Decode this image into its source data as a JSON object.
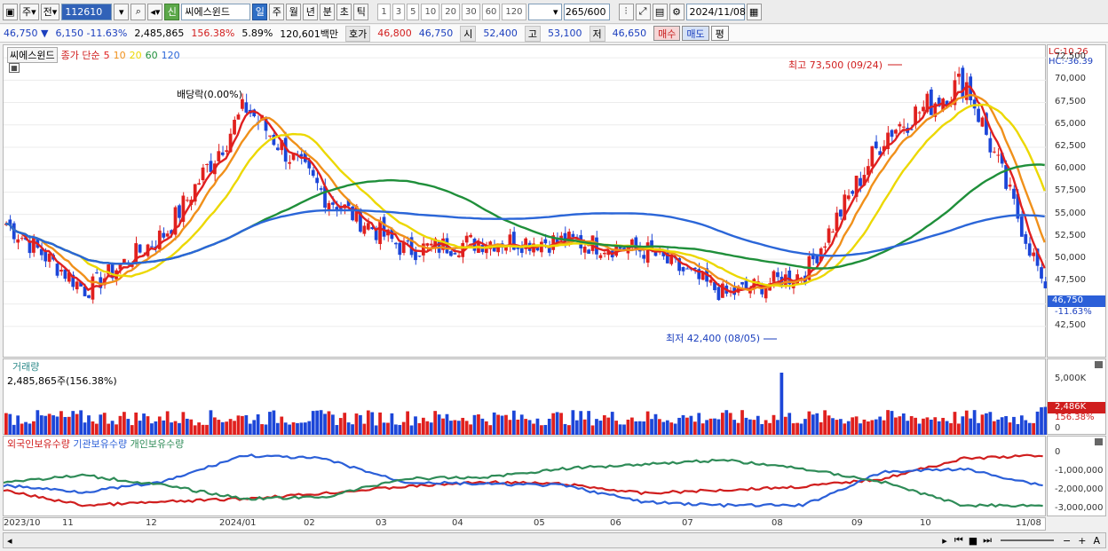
{
  "toolbar": {
    "period": "주",
    "adj": "전",
    "code": "112610",
    "name": "씨에스윈드",
    "badge": "신",
    "periods": [
      "일",
      "주",
      "월",
      "년",
      "분",
      "초",
      "틱"
    ],
    "intervals": [
      "1",
      "3",
      "5",
      "10",
      "20",
      "30",
      "60",
      "120"
    ],
    "count": "265/600",
    "date": "2024/11/08"
  },
  "quote": {
    "price": "46,750",
    "arrow": "▼",
    "change": "6,150",
    "rate": "-11.63%",
    "volume": "2,485,865",
    "vol_ratio": "156.38%",
    "turnover_rate": "5.89%",
    "amount": "120,601백만",
    "bid_label": "호가",
    "bid1": "46,800",
    "bid2": "46,750",
    "open_label": "시",
    "open": "52,400",
    "high_label": "고",
    "high": "53,100",
    "low_label": "저",
    "low": "46,650",
    "buy": "매수",
    "sell": "매도",
    "flat": "평"
  },
  "price_pane": {
    "title": "씨에스윈드",
    "legend_prefix": "종가 단순",
    "legend": [
      {
        "label": "5",
        "color": "#e02020"
      },
      {
        "label": "10",
        "color": "#f0901a"
      },
      {
        "label": "20",
        "color": "#ecd800"
      },
      {
        "label": "60",
        "color": "#1f8f3a"
      },
      {
        "label": "120",
        "color": "#2b66d8"
      }
    ],
    "lc": "LC:10.26",
    "hc": "HC:-36.39",
    "dividend": "배당락(0.00%)",
    "max_label": "최고 73,500 (09/24)",
    "min_label": "최저 42,400 (08/05)",
    "yticks": [
      "72,500",
      "70,000",
      "67,500",
      "65,000",
      "62,500",
      "60,000",
      "57,500",
      "55,000",
      "52,500",
      "50,000",
      "47,500",
      "45,000",
      "42,500"
    ],
    "cur_price": "46,750",
    "cur_rate": "-11.63%"
  },
  "volume_pane": {
    "title": "거래량",
    "value": "2,485,865주(156.38%)",
    "yticks": [
      "5,000K",
      "0"
    ],
    "cur": "2,486K",
    "cur_ratio": "156.38%"
  },
  "holding_pane": {
    "legend": [
      {
        "label": "외국인보유수량",
        "color": "#d01e1e"
      },
      {
        "label": "기관보유수량",
        "color": "#2b5fd8"
      },
      {
        "label": "개인보유수량",
        "color": "#2e8b57"
      }
    ],
    "yticks": [
      "0",
      "-1,000,000",
      "-2,000,000",
      "-3,000,000"
    ]
  },
  "xaxis": [
    "2023/10",
    "11",
    "12",
    "2024/01",
    "02",
    "03",
    "04",
    "05",
    "06",
    "07",
    "08",
    "09",
    "10",
    "11/08"
  ],
  "chart_data": {
    "type": "candlestick",
    "title": "씨에스윈드",
    "xlabel": "",
    "ylabel": "",
    "ylim": [
      40500,
      73500
    ],
    "ma_periods": [
      5,
      10,
      20,
      60,
      120
    ],
    "high": {
      "value": 73500,
      "date": "09/24"
    },
    "low": {
      "value": 42400,
      "date": "08/05"
    },
    "close_anchors": [
      {
        "x": "2023/10",
        "y": 54000
      },
      {
        "x": "11",
        "y": 46500
      },
      {
        "x": "12",
        "y": 53000
      },
      {
        "x": "2024/01",
        "y": 67000
      },
      {
        "x": "02",
        "y": 57000
      },
      {
        "x": "03",
        "y": 51000
      },
      {
        "x": "04",
        "y": 52000
      },
      {
        "x": "05",
        "y": 52000
      },
      {
        "x": "06",
        "y": 51000
      },
      {
        "x": "07",
        "y": 46000
      },
      {
        "x": "08",
        "y": 48500
      },
      {
        "x": "09",
        "y": 64000
      },
      {
        "x": "10",
        "y": 70000
      },
      {
        "x": "11/08",
        "y": 46750
      }
    ],
    "volume_last": "2,485,865"
  }
}
